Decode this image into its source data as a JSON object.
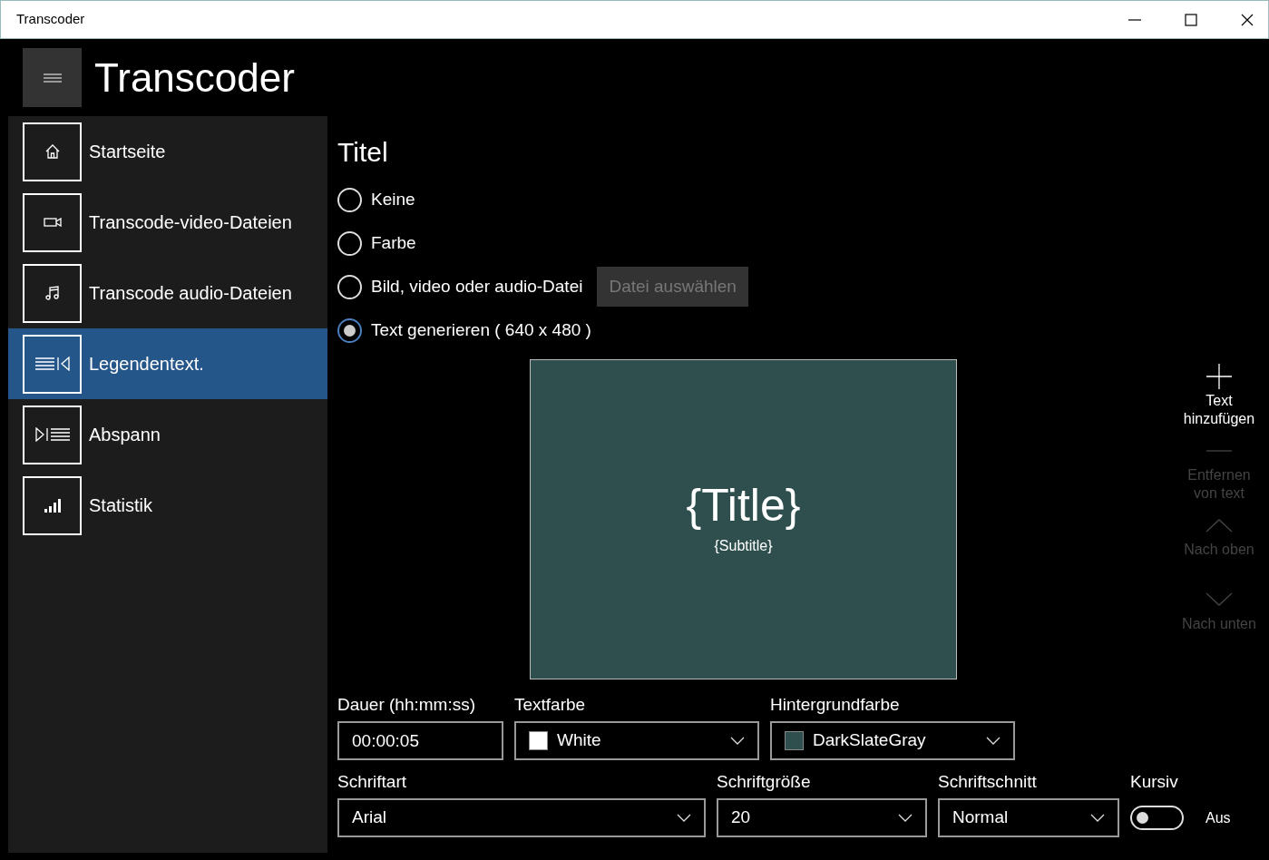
{
  "window": {
    "title": "Transcoder"
  },
  "app_title": "Transcoder",
  "nav": {
    "items": [
      {
        "label": "Startseite",
        "selected": false
      },
      {
        "label": "Transcode-video-Dateien",
        "selected": false
      },
      {
        "label": "Transcode audio-Dateien",
        "selected": false
      },
      {
        "label": "Legendentext.",
        "selected": true
      },
      {
        "label": "Abspann",
        "selected": false
      },
      {
        "label": "Statistik",
        "selected": false
      }
    ]
  },
  "section_title": "Titel",
  "options": [
    {
      "label": "Keine",
      "selected": false
    },
    {
      "label": "Farbe",
      "selected": false
    },
    {
      "label": "Bild, video oder audio-Datei",
      "selected": false,
      "button": {
        "label": "Datei auswählen",
        "disabled": true
      }
    },
    {
      "label": "Text generieren ( 640 x 480 )",
      "selected": true
    }
  ],
  "preview": {
    "title": "{Title}",
    "subtitle": "{Subtitle}",
    "color": "#2f4f4f"
  },
  "toolbar": [
    {
      "label": "Text hinzufügen",
      "disabled": false
    },
    {
      "label": "Entfernen von text",
      "disabled": true
    },
    {
      "label": "Nach oben",
      "disabled": true
    },
    {
      "label": "Nach unten",
      "disabled": true
    }
  ],
  "fields": [
    {
      "kind": "text",
      "label": "Dauer (hh:mm:ss)",
      "value": "00:00:05"
    },
    {
      "kind": "select",
      "label": "Textfarbe",
      "value": "White",
      "color": "#ffffff"
    },
    {
      "kind": "select",
      "label": "Hintergrundfarbe",
      "value": "DarkSlateGray",
      "color": "#2f4f4f"
    },
    {
      "kind": "break"
    },
    {
      "kind": "select",
      "label": "Schriftart",
      "value": "Arial"
    },
    {
      "kind": "select",
      "label": "Schriftgröße",
      "value": "20"
    },
    {
      "kind": "select",
      "label": "Schriftschnitt",
      "value": "Normal"
    },
    {
      "kind": "toggle",
      "label": "Kursiv",
      "on": false,
      "state_text": "Aus"
    }
  ]
}
